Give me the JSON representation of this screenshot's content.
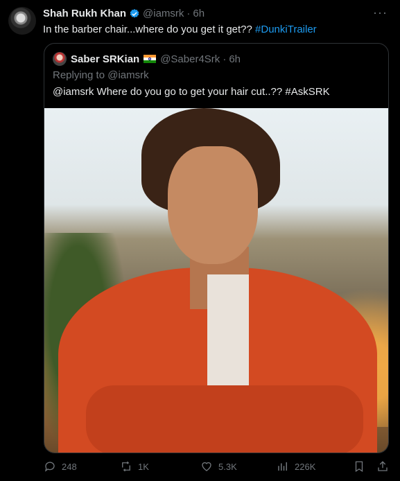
{
  "author": {
    "name": "Shah Rukh Khan",
    "handle": "@iamsrk",
    "separator": "·",
    "time": "6h",
    "text_prefix": "In the barber chair...where do you get it get?? ",
    "hashtag": "#DunkiTrailer",
    "verified_color": "#1d9bf0"
  },
  "more_label": "···",
  "quoted": {
    "name": "Saber SRKian",
    "handle": "@Saber4Srk",
    "separator": "·",
    "time": "6h",
    "replying_label": "Replying to ",
    "replying_handle": "@iamsrk",
    "text": "@iamsrk Where do you go to get your hair cut..?? #AskSRK"
  },
  "actions": {
    "replies": "248",
    "reposts": "1K",
    "likes": "5.3K",
    "views": "226K"
  },
  "colors": {
    "link": "#1d9bf0",
    "muted": "#71767b",
    "border": "#2f3336"
  }
}
